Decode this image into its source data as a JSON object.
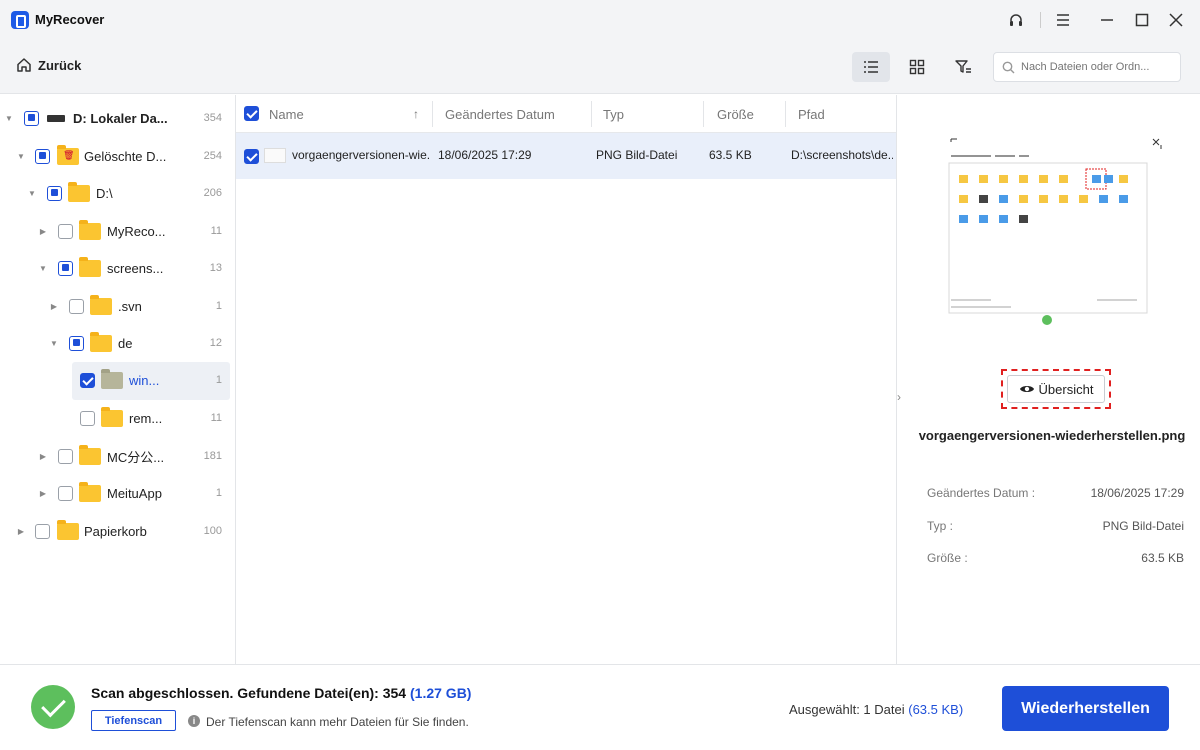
{
  "app": {
    "title": "MyRecover"
  },
  "toolbar": {
    "back_label": "Zurück",
    "search_placeholder": "Nach Dateien oder Ordn..."
  },
  "tree": [
    {
      "label": "D: Lokaler Da...",
      "count": "354",
      "state": "partial",
      "icon": "drive-icon"
    },
    {
      "label": "Gelöschte D...",
      "count": "254",
      "state": "partial",
      "icon": "deleted-folder-icon"
    },
    {
      "label": "D:\\",
      "count": "206",
      "state": "partial",
      "icon": "folder-icon"
    },
    {
      "label": "MyReco...",
      "count": "11",
      "state": "unchecked",
      "icon": "folder-icon"
    },
    {
      "label": "screens...",
      "count": "13",
      "state": "partial",
      "icon": "folder-icon"
    },
    {
      "label": ".svn",
      "count": "1",
      "state": "unchecked",
      "icon": "folder-icon"
    },
    {
      "label": "de",
      "count": "12",
      "state": "partial",
      "icon": "folder-icon"
    },
    {
      "label": "win...",
      "count": "1",
      "state": "checked",
      "icon": "folder-icon"
    },
    {
      "label": "rem...",
      "count": "11",
      "state": "unchecked",
      "icon": "folder-icon"
    },
    {
      "label": "MC分公...",
      "count": "181",
      "state": "unchecked",
      "icon": "folder-icon"
    },
    {
      "label": "MeituApp",
      "count": "1",
      "state": "unchecked",
      "icon": "folder-icon"
    },
    {
      "label": "Papierkorb",
      "count": "100",
      "state": "unchecked",
      "icon": "recycle-folder-icon"
    }
  ],
  "filelist": {
    "columns": [
      "Name",
      "Geändertes Datum",
      "Typ",
      "Größe",
      "Pfad"
    ],
    "rows": [
      {
        "name": "vorgaengerversionen-wie...",
        "date": "18/06/2025 17:29",
        "type": "PNG Bild-Datei",
        "size": "63.5 KB",
        "path": "D:\\screenshots\\de..."
      }
    ]
  },
  "preview": {
    "overview_label": "Übersicht",
    "filename": "vorgaengerversionen-wiederherstellen.png",
    "meta": [
      {
        "label": "Geändertes Datum :",
        "value": "18/06/2025 17:29"
      },
      {
        "label": "Typ :",
        "value": "PNG Bild-Datei"
      },
      {
        "label": "Größe :",
        "value": "63.5 KB"
      }
    ]
  },
  "status": {
    "scan_prefix": "Scan abgeschlossen. Gefundene Datei(en): 354",
    "scan_size": "(1.27 GB)",
    "deep_scan_label": "Tiefenscan",
    "deep_scan_hint": "Der Tiefenscan kann mehr Dateien für Sie finden.",
    "selected_prefix": "Ausgewählt: 1 Datei",
    "selected_size": "(63.5 KB)",
    "recover_label": "Wiederherstellen"
  },
  "colors": {
    "accent": "#1e4fd8",
    "success": "#5dbf5d",
    "highlight": "#e02020"
  }
}
